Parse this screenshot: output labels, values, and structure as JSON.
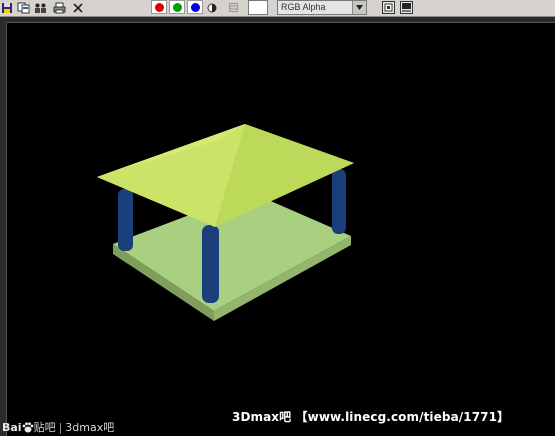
{
  "toolbar": {
    "tools": [
      {
        "icon": "save-image-icon"
      },
      {
        "icon": "copy-image-icon"
      },
      {
        "icon": "clone-window-icon"
      },
      {
        "icon": "print-icon"
      },
      {
        "icon": "close-icon"
      }
    ],
    "channels": [
      {
        "icon": "red-channel-icon",
        "color": "#e00000"
      },
      {
        "icon": "green-channel-icon",
        "color": "#00a000"
      },
      {
        "icon": "blue-channel-icon",
        "color": "#0000e0"
      }
    ],
    "monochrome_icon": "monochrome-icon",
    "clear_icon": "clear-icon",
    "color_swatch": "#ffffff",
    "channel_display": {
      "value": "RGB Alpha"
    },
    "frame_icons": [
      "frame-buffer-icon",
      "display-icon"
    ]
  },
  "viewport": {
    "background": "#000000",
    "scene": {
      "roof_color": "#c8e060",
      "floor_color": "#a8d080",
      "pillar_color": "#1a3f7a"
    }
  },
  "watermarks": {
    "left_brand": "Bai",
    "left_service": "贴吧",
    "left_forum": "3dmax吧",
    "right": "3Dmax吧 【www.linecg.com/tieba/1771】"
  }
}
